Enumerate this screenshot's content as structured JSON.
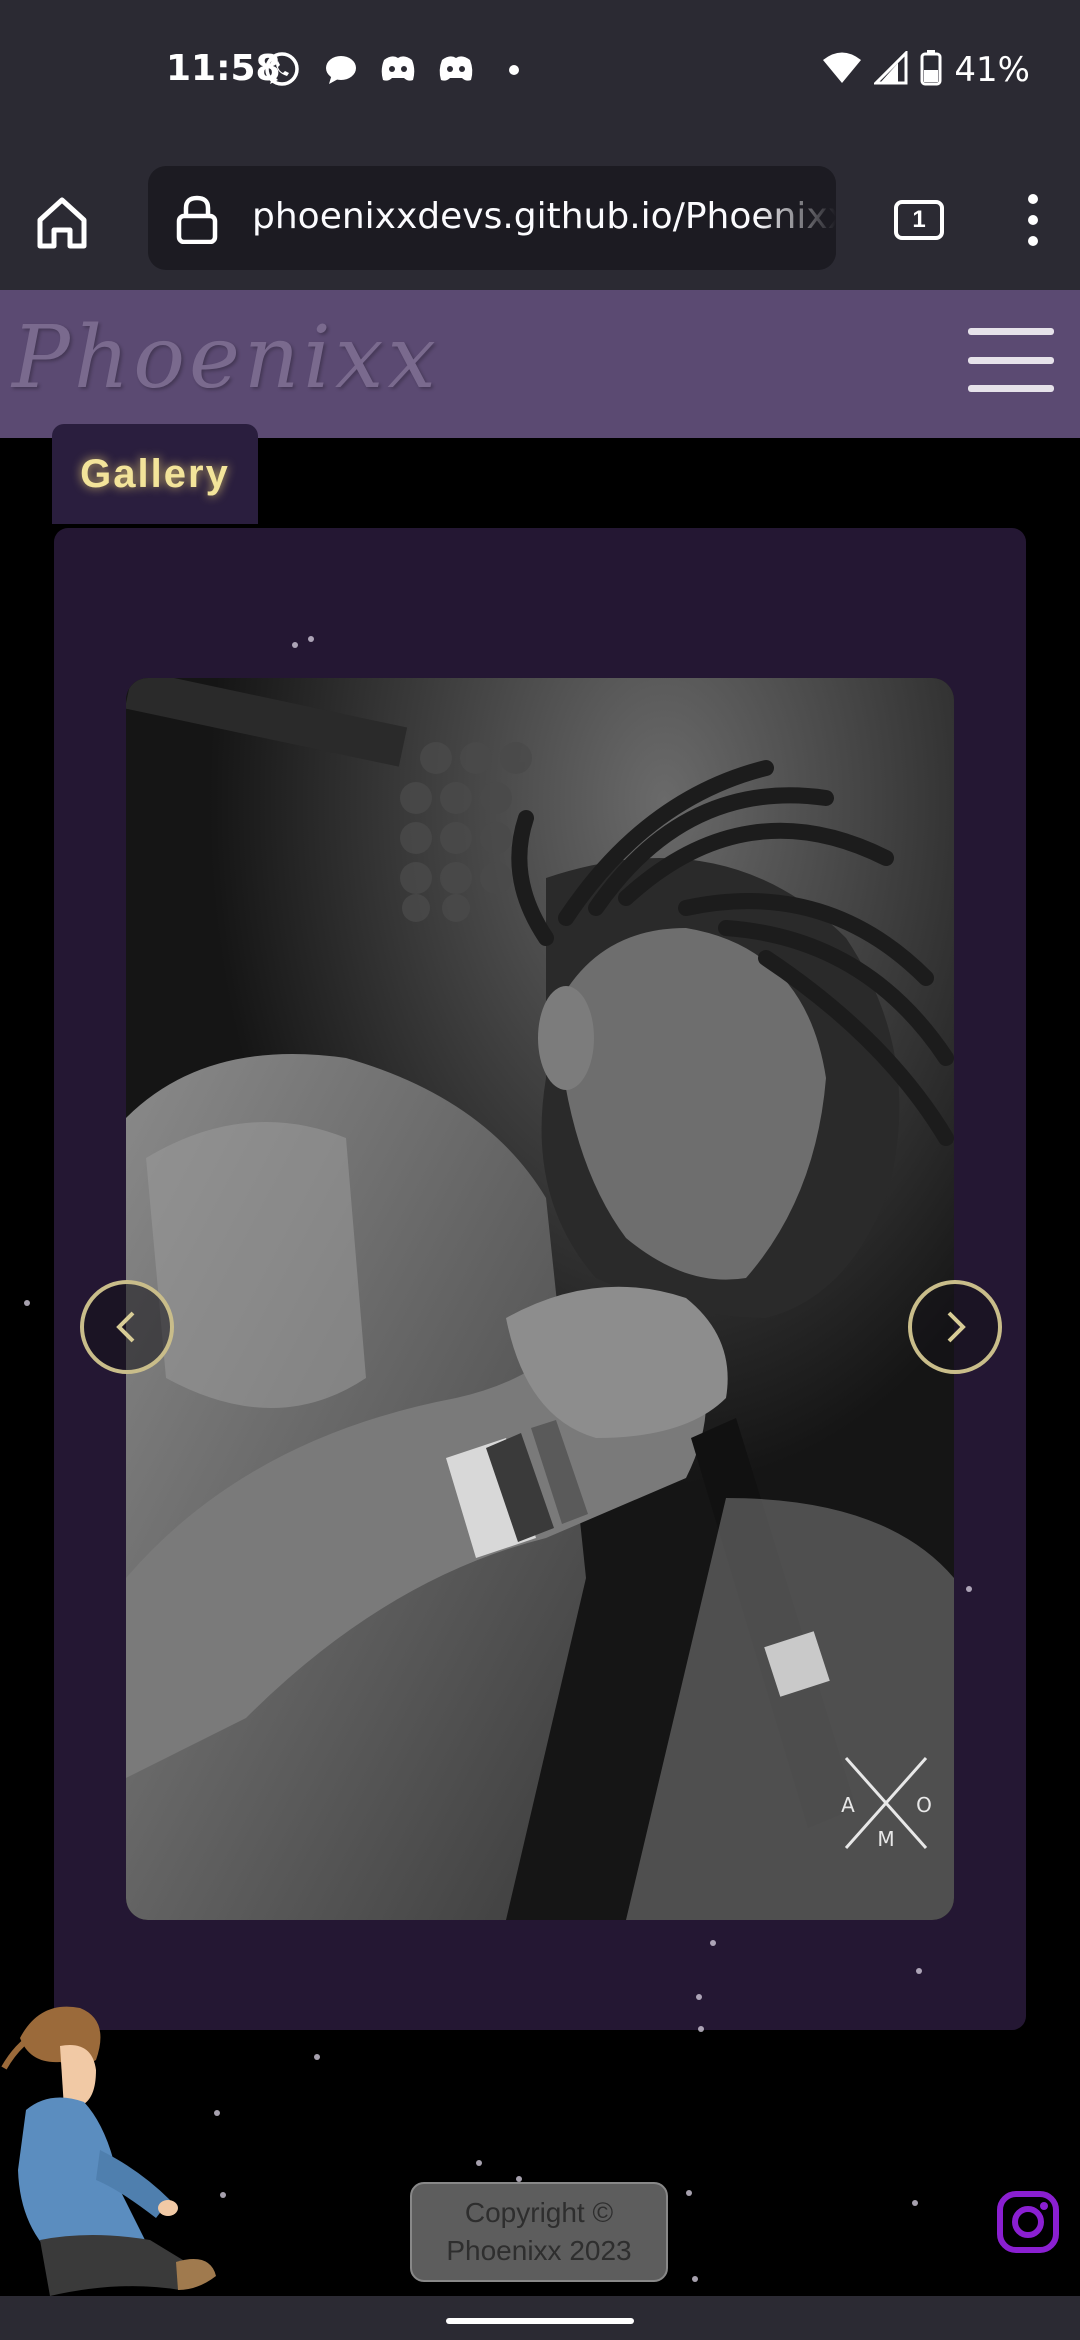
{
  "status_bar": {
    "time": "11:58",
    "battery": "41%",
    "notification_icons": [
      "whatsapp-icon",
      "chat-bubble-icon",
      "discord-icon",
      "discord-icon",
      "dot-icon"
    ]
  },
  "browser": {
    "url": "phoenixxdevs.github.io/Phoenixx-",
    "tab_count": "1"
  },
  "site": {
    "logo": "Phoenixx",
    "section_tab": "Gallery",
    "photo_watermark": {
      "letters": [
        "A",
        "O",
        "M"
      ]
    },
    "copyright_line1": "Copyright ©",
    "copyright_line2": "Phoenixx 2023"
  },
  "colors": {
    "header_bg": "#5b4a72",
    "panel_bg": "#241733",
    "gallery_text": "#f3e49a",
    "arrow_border": "#c9bd8a",
    "instagram": "#8a1fd1"
  }
}
